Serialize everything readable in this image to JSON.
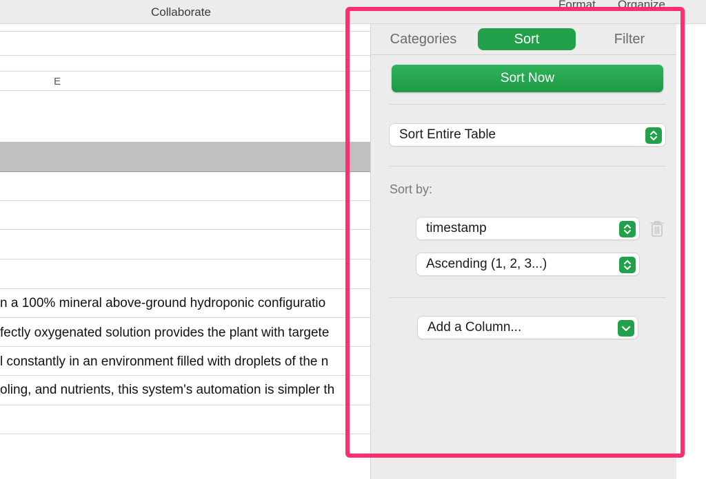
{
  "toolbar": {
    "collaborate_label": "Collaborate",
    "format_label": "Format",
    "organize_label": "Organize"
  },
  "sheet": {
    "column_header": "E",
    "rows": [
      "n a 100% mineral above-ground hydroponic configuratio",
      "fectly oxygenated solution provides the plant with targete",
      "l constantly in an environment filled with droplets of the n",
      "oling, and nutrients, this system's automation is simpler th"
    ]
  },
  "sidebar": {
    "tabs": [
      {
        "label": "Categories",
        "active": false
      },
      {
        "label": "Sort",
        "active": true
      },
      {
        "label": "Filter",
        "active": false
      }
    ],
    "sort_now_label": "Sort Now",
    "scope_select": "Sort Entire Table",
    "sort_by_label": "Sort by:",
    "rule": {
      "column": "timestamp",
      "order": "Ascending (1, 2, 3...)"
    },
    "add_column_select": "Add a Column..."
  },
  "colors": {
    "accent": "#23a14a",
    "highlight": "#ff2e6e",
    "header_band": "#bfc1c0"
  },
  "icons": {
    "stepper": "up-down-chevron-icon",
    "dropdown": "chevron-down-icon",
    "delete": "trash-icon"
  }
}
